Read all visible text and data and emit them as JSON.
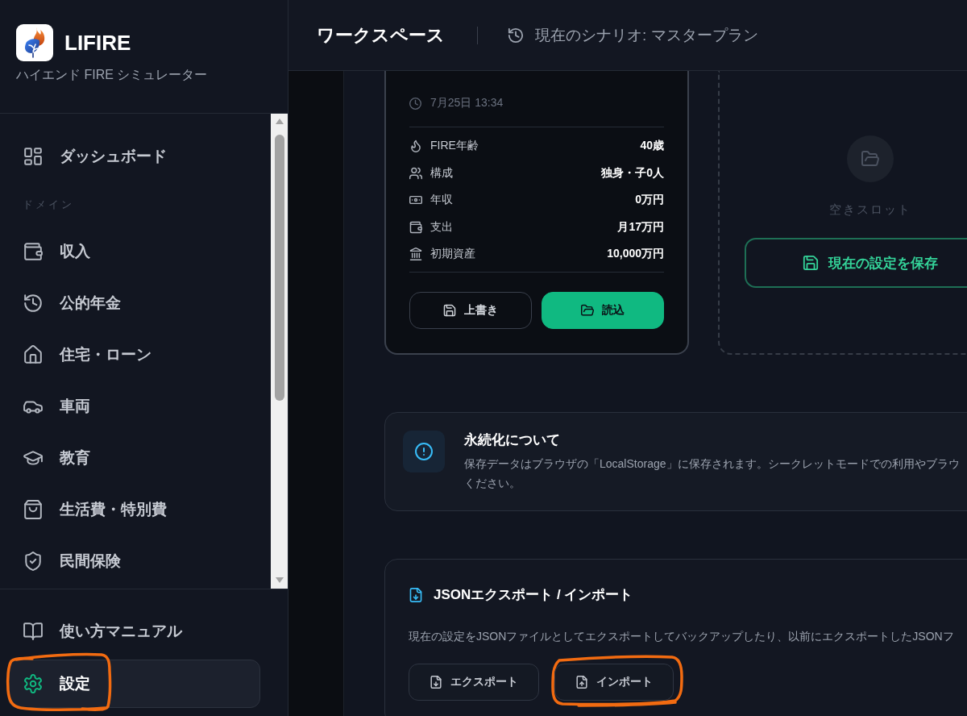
{
  "sidebar": {
    "app_name": "LIFIRE",
    "tagline": "ハイエンド FIRE シミュレーター",
    "top_items": [
      {
        "label": "ダッシュボード",
        "selected": false,
        "circled": false
      }
    ],
    "section_label": "ドメイン",
    "domain_items": [
      {
        "label": "収入",
        "selected": false,
        "circled": false
      },
      {
        "label": "公的年金",
        "selected": false,
        "circled": false
      },
      {
        "label": "住宅・ローン",
        "selected": false,
        "circled": false
      },
      {
        "label": "車両",
        "selected": false,
        "circled": false
      },
      {
        "label": "教育",
        "selected": false,
        "circled": false
      },
      {
        "label": "生活費・特別費",
        "selected": false,
        "circled": false
      },
      {
        "label": "民間保険",
        "selected": false,
        "circled": false
      }
    ],
    "footer_items": [
      {
        "label": "使い方マニュアル",
        "selected": false,
        "circled": false
      },
      {
        "label": "設定",
        "selected": true,
        "circled": true
      }
    ]
  },
  "header": {
    "title": "ワークスペース",
    "scenario": "現在のシナリオ: マスタープラン"
  },
  "slots": [
    {
      "kind": "filled",
      "saved_at": "7月25日 13:34",
      "stats": [
        {
          "label": "FIRE年齢",
          "value": "40歳"
        },
        {
          "label": "構成",
          "value": "独身・子0人"
        },
        {
          "label": "年収",
          "value": "0万円"
        },
        {
          "label": "支出",
          "value": "月17万円"
        },
        {
          "label": "初期資産",
          "value": "10,000万円"
        }
      ],
      "buttons": [
        {
          "label": "上書き",
          "kind": "outline"
        },
        {
          "label": "読込",
          "kind": "primary"
        }
      ]
    },
    {
      "kind": "empty",
      "empty_label": "空きスロット",
      "save_button": "現在の設定を保存"
    }
  ],
  "persistence_note": {
    "title": "永続化について",
    "lines": [
      "保存データはブラウザの「LocalStorage」に保存されます。シークレットモードでの利用やブラウ",
      "ください。"
    ]
  },
  "json_transfer": {
    "title": "JSONエクスポート / インポート",
    "description": "現在の設定をJSONファイルとしてエクスポートしてバックアップしたり、以前にエクスポートしたJSONフ",
    "buttons": [
      {
        "label": "エクスポート",
        "circled": false
      },
      {
        "label": "インポート",
        "circled": true
      }
    ]
  }
}
